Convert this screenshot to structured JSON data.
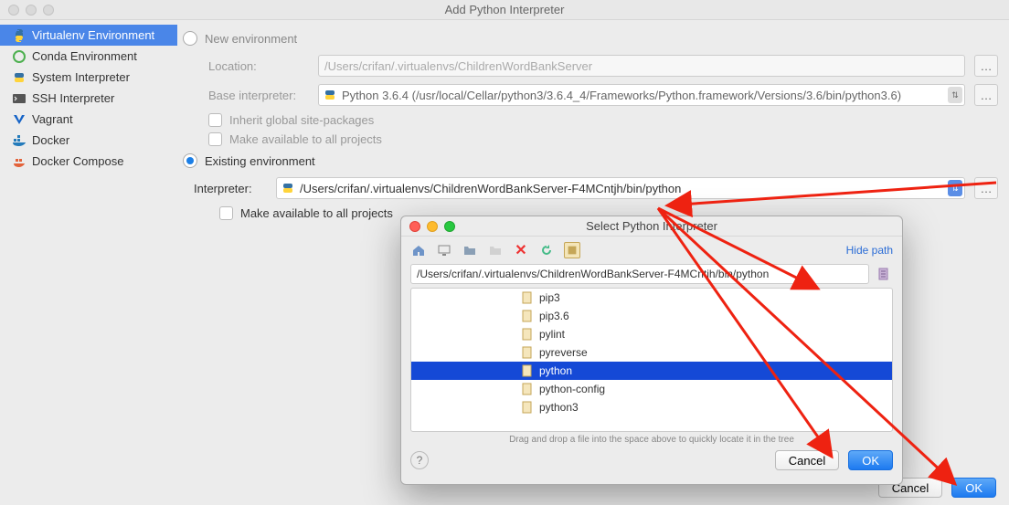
{
  "window": {
    "title": "Add Python Interpreter"
  },
  "sidebar": {
    "items": [
      {
        "label": "Virtualenv Environment",
        "icon": "python",
        "selected": true
      },
      {
        "label": "Conda Environment",
        "icon": "conda",
        "selected": false
      },
      {
        "label": "System Interpreter",
        "icon": "python",
        "selected": false
      },
      {
        "label": "SSH Interpreter",
        "icon": "ssh",
        "selected": false
      },
      {
        "label": "Vagrant",
        "icon": "vagrant",
        "selected": false
      },
      {
        "label": "Docker",
        "icon": "docker",
        "selected": false
      },
      {
        "label": "Docker Compose",
        "icon": "docker-compose",
        "selected": false
      }
    ]
  },
  "new_env": {
    "radio_label": "New environment",
    "location_label": "Location:",
    "location_value": "/Users/crifan/.virtualenvs/ChildrenWordBankServer",
    "base_label": "Base interpreter:",
    "base_value": "Python 3.6.4 (/usr/local/Cellar/python3/3.6.4_4/Frameworks/Python.framework/Versions/3.6/bin/python3.6)",
    "inherit_label": "Inherit global site-packages",
    "available_label": "Make available to all projects"
  },
  "existing": {
    "radio_label": "Existing environment",
    "interpreter_label": "Interpreter:",
    "interpreter_value": "/Users/crifan/.virtualenvs/ChildrenWordBankServer-F4MCntjh/bin/python",
    "available_label": "Make available to all projects"
  },
  "buttons": {
    "cancel": "Cancel",
    "ok": "OK"
  },
  "dialog": {
    "title": "Select Python Interpreter",
    "hide_path": "Hide path",
    "path": "/Users/crifan/.virtualenvs/ChildrenWordBankServer-F4MCntjh/bin/python",
    "files": [
      {
        "name": "pip3",
        "selected": false
      },
      {
        "name": "pip3.6",
        "selected": false
      },
      {
        "name": "pylint",
        "selected": false
      },
      {
        "name": "pyreverse",
        "selected": false
      },
      {
        "name": "python",
        "selected": true
      },
      {
        "name": "python-config",
        "selected": false
      },
      {
        "name": "python3",
        "selected": false
      }
    ],
    "drag_hint": "Drag and drop a file into the space above to quickly locate it in the tree",
    "cancel": "Cancel",
    "ok": "OK"
  }
}
